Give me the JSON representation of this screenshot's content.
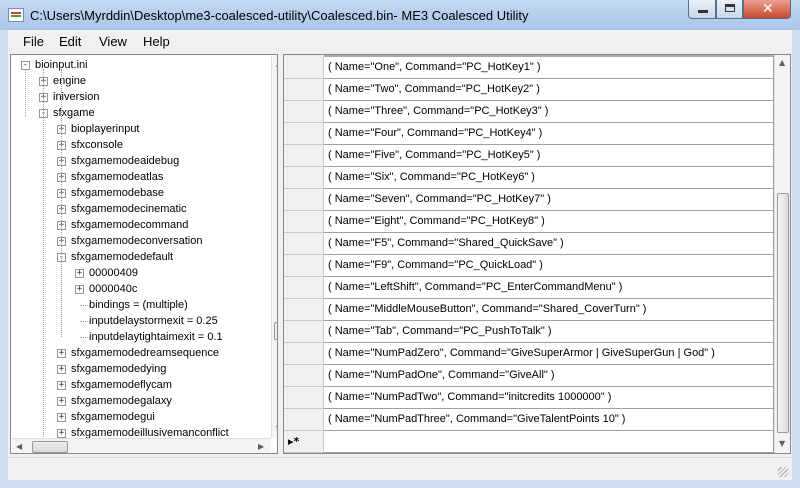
{
  "window": {
    "title": "C:\\Users\\Myrddin\\Desktop\\me3-coalesced-utility\\Coalesced.bin- ME3 Coalesced Utility"
  },
  "menu": [
    {
      "label": "File"
    },
    {
      "label": "Edit"
    },
    {
      "label": "View"
    },
    {
      "label": "Help"
    }
  ],
  "tree": {
    "nodes": [
      {
        "label": "bioinput.ini",
        "depth": 0,
        "expander": "-"
      },
      {
        "label": "engine",
        "depth": 1,
        "expander": "+"
      },
      {
        "label": "iniversion",
        "depth": 1,
        "expander": "+"
      },
      {
        "label": "sfxgame",
        "depth": 1,
        "expander": "-"
      },
      {
        "label": "bioplayerinput",
        "depth": 2,
        "expander": "+"
      },
      {
        "label": "sfxconsole",
        "depth": 2,
        "expander": "+"
      },
      {
        "label": "sfxgamemodeaidebug",
        "depth": 2,
        "expander": "+"
      },
      {
        "label": "sfxgamemodeatlas",
        "depth": 2,
        "expander": "+"
      },
      {
        "label": "sfxgamemodebase",
        "depth": 2,
        "expander": "+"
      },
      {
        "label": "sfxgamemodecinematic",
        "depth": 2,
        "expander": "+"
      },
      {
        "label": "sfxgamemodecommand",
        "depth": 2,
        "expander": "+"
      },
      {
        "label": "sfxgamemodeconversation",
        "depth": 2,
        "expander": "+"
      },
      {
        "label": "sfxgamemodedefault",
        "depth": 2,
        "expander": "-"
      },
      {
        "label": "00000409",
        "depth": 3,
        "expander": "+"
      },
      {
        "label": "0000040c",
        "depth": 3,
        "expander": "+"
      },
      {
        "label": "bindings = (multiple)",
        "depth": 3,
        "expander": ""
      },
      {
        "label": "inputdelaystormexit = 0.25",
        "depth": 3,
        "expander": ""
      },
      {
        "label": "inputdelaytightaimexit = 0.1",
        "depth": 3,
        "expander": ""
      },
      {
        "label": "sfxgamemodedreamsequence",
        "depth": 2,
        "expander": "+"
      },
      {
        "label": "sfxgamemodedying",
        "depth": 2,
        "expander": "+"
      },
      {
        "label": "sfxgamemodeflycam",
        "depth": 2,
        "expander": "+"
      },
      {
        "label": "sfxgamemodegalaxy",
        "depth": 2,
        "expander": "+"
      },
      {
        "label": "sfxgamemodegui",
        "depth": 2,
        "expander": "+"
      },
      {
        "label": "sfxgamemodeillusivemanconflict",
        "depth": 2,
        "expander": "+"
      }
    ]
  },
  "grid": {
    "rows": [
      "( Name=\"One\", Command=\"PC_HotKey1\" )",
      "( Name=\"Two\", Command=\"PC_HotKey2\" )",
      "( Name=\"Three\", Command=\"PC_HotKey3\" )",
      "( Name=\"Four\", Command=\"PC_HotKey4\" )",
      "( Name=\"Five\", Command=\"PC_HotKey5\" )",
      "( Name=\"Six\", Command=\"PC_HotKey6\" )",
      "( Name=\"Seven\", Command=\"PC_HotKey7\" )",
      "( Name=\"Eight\", Command=\"PC_HotKey8\" )",
      "( Name=\"F5\", Command=\"Shared_QuickSave\" )",
      "( Name=\"F9\", Command=\"PC_QuickLoad\" )",
      "( Name=\"LeftShift\", Command=\"PC_EnterCommandMenu\" )",
      "( Name=\"MiddleMouseButton\", Command=\"Shared_CoverTurn\" )",
      "( Name=\"Tab\", Command=\"PC_PushToTalk\" )",
      "( Name=\"NumPadZero\", Command=\"GiveSuperArmor | GiveSuperGun | God\" )",
      "( Name=\"NumPadOne\", Command=\"GiveAll\" )",
      "( Name=\"NumPadTwo\", Command=\"initcredits 1000000\" )",
      "( Name=\"NumPadThree\", Command=\"GiveTalentPoints 10\" )"
    ],
    "new_row_marker": "▸*",
    "new_row_value": ""
  },
  "icons": {
    "app": "app-icon",
    "minimize": "minimize-icon",
    "maximize": "maximize-icon",
    "close": "close-icon",
    "close_glyph": "✕",
    "scroll_up": "▲",
    "scroll_down": "▼",
    "scroll_left": "◀",
    "scroll_right": "▶",
    "resize": "resize-grip-icon"
  },
  "colors": {
    "title_bar": "#b5cde9",
    "close_button": "#c9492f",
    "grid_background": "#aaaaaa"
  }
}
